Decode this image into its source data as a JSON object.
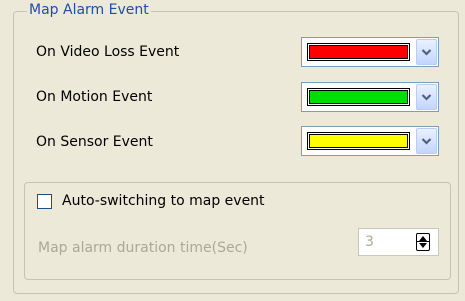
{
  "group": {
    "title": "Map Alarm Event"
  },
  "events": [
    {
      "label": "On Video Loss Event",
      "color": "#ff0000"
    },
    {
      "label": "On Motion Event",
      "color": "#00dd00"
    },
    {
      "label": "On Sensor Event",
      "color": "#ffff00"
    }
  ],
  "icons": {
    "dropdown": "chevron-down-icon",
    "spinner": "up-down-spinner-icon"
  },
  "auto_switch": {
    "label": "Auto-switching to map event",
    "checked": false
  },
  "duration": {
    "label": "Map alarm duration time(Sec)",
    "value": "3",
    "enabled": false
  }
}
